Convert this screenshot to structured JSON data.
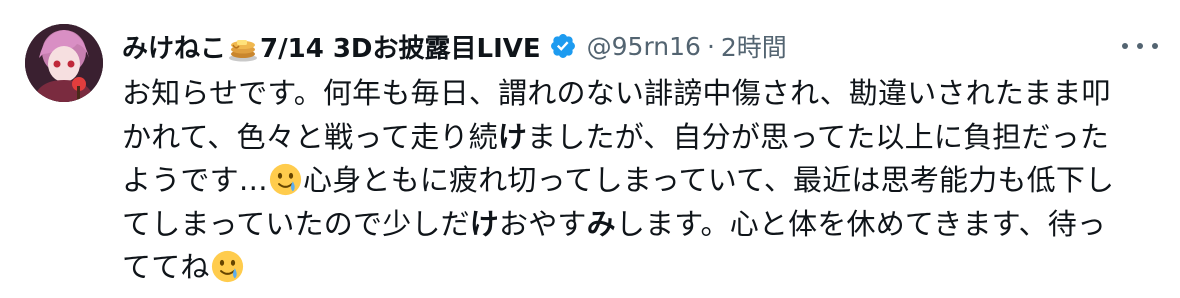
{
  "tweet": {
    "display_name": "みけねこ",
    "name_suffix": "7/14 3Dお披露目LIVE",
    "pancake_emoji": "pancake-icon",
    "verified_icon": "verified-badge-icon",
    "handle": "@95rn16",
    "separator": "·",
    "time": "2時間",
    "more_icon": "more-options-icon",
    "body_lines": [
      [
        "お知らせです。何年も毎日、謂れのない誹謗中傷され、勘違いされたまま叩"
      ],
      [
        "かれて、色々と戦って走り続",
        "け",
        "ましたが、自分が思ってた以上に負担だった"
      ],
      [
        "ようです…",
        "心身ともに疲れ切ってしまっていて、最近は思考能力も低下し"
      ],
      [
        "てしまっていたので少しだ",
        "け",
        "おやす",
        "み",
        "します。心と体を休めてきます、待っ"
      ],
      [
        "ててね"
      ]
    ],
    "emoji_name": "tear-smile-emoji",
    "colors": {
      "text": "#0f1419",
      "secondary": "#536471",
      "verified": "#1d9bf0",
      "emoji_yellow": "#ffcc4d",
      "tear": "#5dadec"
    }
  }
}
